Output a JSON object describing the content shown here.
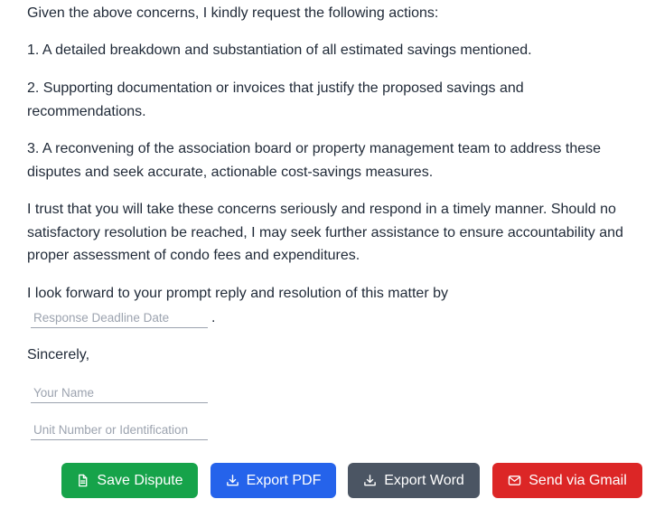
{
  "letter": {
    "p1": "Given the above concerns, I kindly request the following actions:",
    "p2": "1. A detailed breakdown and substantiation of all estimated savings mentioned.",
    "p3": "2. Supporting documentation or invoices that justify the proposed savings and recommendations.",
    "p4": "3. A reconvening of the association board or property management team to address these disputes and seek accurate, actionable cost-savings measures.",
    "p5": "I trust that you will take these concerns seriously and respond in a timely manner. Should no satisfactory resolution be reached, I may seek further assistance to ensure accountability and proper assessment of condo fees and expenditures.",
    "p6": "I look forward to your prompt reply and resolution of this matter by",
    "period": ".",
    "closing": "Sincerely,"
  },
  "fields": {
    "deadline": {
      "value": "",
      "placeholder": "Response Deadline Date"
    },
    "name": {
      "value": "",
      "placeholder": "Your Name"
    },
    "unit": {
      "value": "",
      "placeholder": "Unit Number or Identification"
    }
  },
  "actions": {
    "save": {
      "label": "Save Dispute",
      "icon": "document-icon",
      "color": "#16a34a"
    },
    "pdf": {
      "label": "Export PDF",
      "icon": "download-icon",
      "color": "#2563eb"
    },
    "word": {
      "label": "Export Word",
      "icon": "download-icon",
      "color": "#4b5563"
    },
    "gmail": {
      "label": "Send via Gmail",
      "icon": "mail-icon",
      "color": "#dc2626"
    }
  }
}
